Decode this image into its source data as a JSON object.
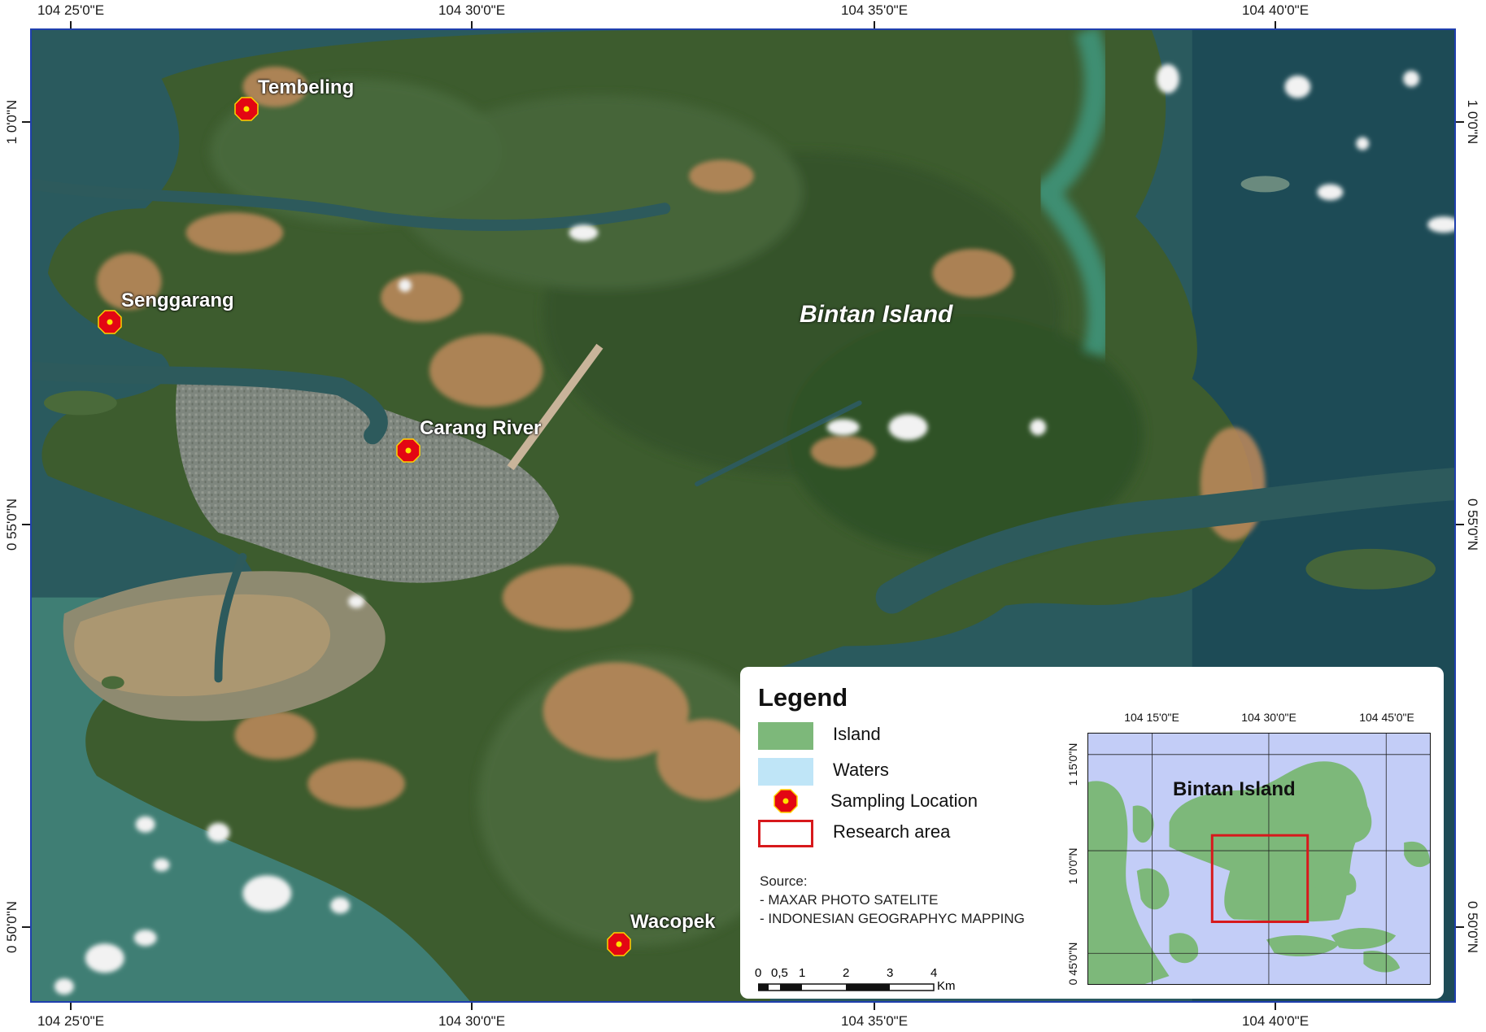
{
  "coords": {
    "longitudes": [
      "104 25'0\"E",
      "104 30'0\"E",
      "104 35'0\"E",
      "104 40'0\"E"
    ],
    "latitudes": [
      "1 0'0\"N",
      "0 55'0\"N",
      "0 50'0\"N"
    ]
  },
  "map": {
    "island_label": "Bintan Island",
    "sites": [
      {
        "name": "Tembeling"
      },
      {
        "name": "Senggarang"
      },
      {
        "name": "Carang River"
      },
      {
        "name": "Wacopek"
      }
    ]
  },
  "legend": {
    "title": "Legend",
    "items": [
      {
        "label": "Island",
        "color": "#7db87a"
      },
      {
        "label": "Waters",
        "color": "#bfe5f7"
      },
      {
        "label": "Sampling Location",
        "color": "#e30613"
      },
      {
        "label": "Research area",
        "color": "#d7191c"
      }
    ],
    "source_title": "Source:",
    "source_lines": [
      "- MAXAR PHOTO SATELITE",
      "- INDONESIAN GEOGRAPHYC MAPPING"
    ],
    "scale": {
      "ticks": [
        "0",
        "0,5",
        "1",
        "2",
        "3",
        "4"
      ],
      "unit": "Km"
    }
  },
  "inset": {
    "longitudes": [
      "104 15'0\"E",
      "104 30'0\"E",
      "104 45'0\"E"
    ],
    "latitudes": [
      "1 15'0\"N",
      "1 0'0\"N",
      "0 45'0\"N"
    ],
    "label": "Bintan Island"
  },
  "colors": {
    "frame": "#1f3fae",
    "sea_deep": "#1d4b56",
    "sea_shallow": "#3f7e74",
    "land_green": "#3a5a2c",
    "land_clearing": "#c0885c",
    "urban": "#8c8f92",
    "inset_sea": "#c3cdf7",
    "inset_land": "#7db87a"
  }
}
